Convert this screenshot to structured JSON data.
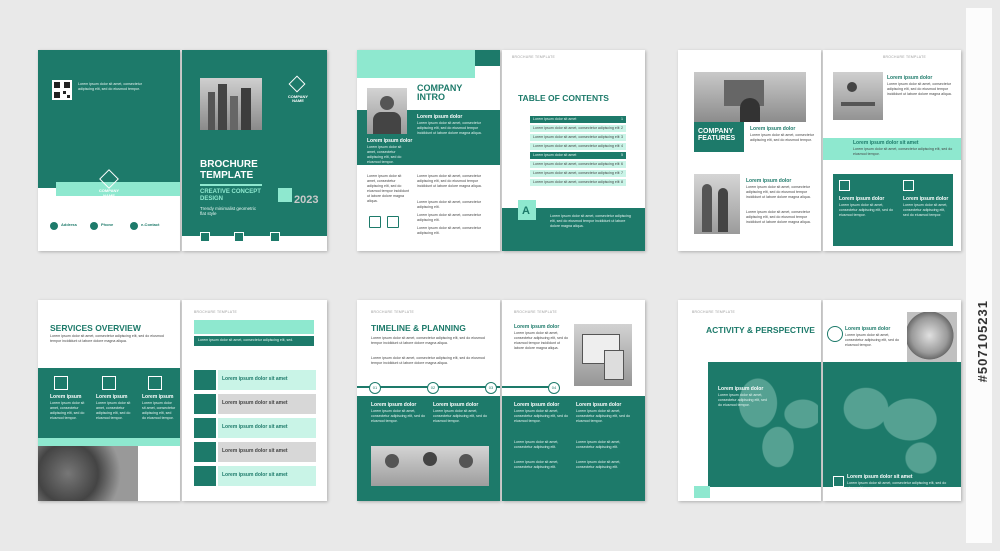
{
  "colors": {
    "primary": "#1d7a6a",
    "accent": "#8ee8cf",
    "light": "#c9f4e7"
  },
  "common": {
    "header_tag": "BROCHURE TEMPLATE",
    "lorem_short": "Lorem ipsum dolor sit amet, consectetur adipiscing elit, sed do eiusmod tempor incididunt ut labore dolore magna aliqua.",
    "lorem_tiny": "Lorem ipsum dolor sit amet, consectetur adipiscing elit, sed do eiusmod tempor.",
    "lorem_label": "Lorem ipsum dolor",
    "lorem_item": "Lorem ipsum dolor sit amet, consectetur adipiscing elit."
  },
  "cover_back": {
    "company": "COMPANY NAME",
    "contacts": [
      "Address",
      "Phone",
      "e-Contact"
    ]
  },
  "cover_front": {
    "title": "BROCHURE TEMPLATE",
    "subtitle": "CREATIVE CONCEPT DESIGN",
    "tagline": "Trendy minimalist geometric flat style",
    "year": "2023",
    "company": "COMPANY NAME"
  },
  "intro": {
    "title": "COMPANY INTRO",
    "label": "Lorem ipsum dolor"
  },
  "toc": {
    "title": "TABLE OF CONTENTS",
    "rows": [
      {
        "text": "Lorem ipsum dolor sit amet",
        "num": "1"
      },
      {
        "text": "Lorem ipsum dolor sit amet, consectetur adipiscing elit",
        "num": "2"
      },
      {
        "text": "Lorem ipsum dolor sit amet, consectetur adipiscing elit",
        "num": "3"
      },
      {
        "text": "Lorem ipsum dolor sit amet, consectetur adipiscing elit",
        "num": "4"
      },
      {
        "text": "Lorem ipsum dolor sit amet",
        "num": "5"
      },
      {
        "text": "Lorem ipsum dolor sit amet, consectetur adipiscing elit",
        "num": "6"
      },
      {
        "text": "Lorem ipsum dolor sit amet, consectetur adipiscing elit",
        "num": "7"
      },
      {
        "text": "Lorem ipsum dolor sit amet, consectetur adipiscing elit",
        "num": "8"
      }
    ]
  },
  "features": {
    "title": "COMPANY FEATURES",
    "label": "Lorem ipsum dolor",
    "label2": "Lorem ipsum dolor sit amet"
  },
  "services": {
    "title": "SERVICES OVERVIEW",
    "items": [
      "Lorem ipsum",
      "Lorem ipsum",
      "Lorem ipsum"
    ],
    "list": [
      "Lorem ipsum dolor sit amet",
      "Lorem ipsum dolor sit amet",
      "Lorem ipsum dolor sit amet",
      "Lorem ipsum dolor sit amet",
      "Lorem ipsum dolor sit amet"
    ],
    "bar": "Lorem ipsum dolor sit amet, consectetur adipiscing elit, sed."
  },
  "timeline": {
    "title": "TIMELINE & PLANNING",
    "steps": [
      "01",
      "02",
      "03",
      "04"
    ]
  },
  "activity": {
    "title": "ACTIVITY & PERSPECTIVE",
    "label": "Lorem ipsum dolor",
    "label2": "Lorem ipsum dolor sit amet"
  },
  "watermark": {
    "id": "#507105231"
  }
}
